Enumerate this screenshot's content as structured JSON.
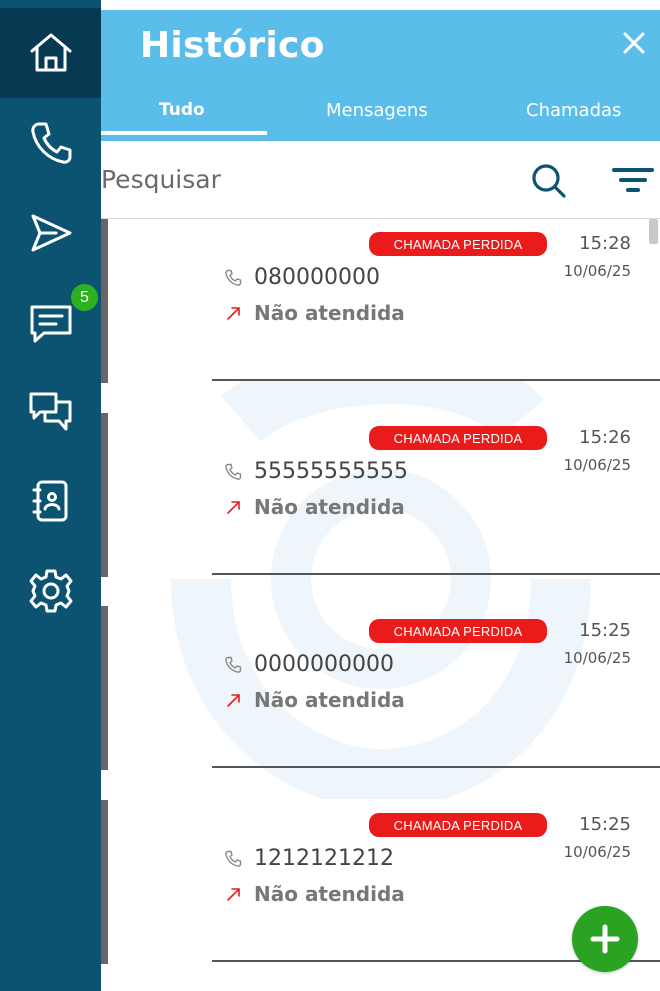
{
  "sidebar": {
    "items": [
      {
        "icon": "home-icon"
      },
      {
        "icon": "phone-icon"
      },
      {
        "icon": "send-icon"
      },
      {
        "icon": "message-icon",
        "badge": "5"
      },
      {
        "icon": "chat-icon"
      },
      {
        "icon": "contacts-icon"
      },
      {
        "icon": "gear-icon"
      }
    ],
    "badge_color": "#2db11f"
  },
  "header": {
    "title": "Histórico",
    "close_icon": "close-icon",
    "tabs": [
      {
        "label": "Tudo",
        "active": true
      },
      {
        "label": "Mensagens",
        "active": false
      },
      {
        "label": "Chamadas",
        "active": false
      }
    ]
  },
  "search": {
    "placeholder": "Pesquisar",
    "search_icon": "search-icon",
    "filter_icon": "filter-icon"
  },
  "history": [
    {
      "tag": "CHAMADA PERDIDA",
      "time": "15:28",
      "date": "10/06/25",
      "number": "080000000",
      "status": "Não atendida"
    },
    {
      "tag": "CHAMADA PERDIDA",
      "time": "15:26",
      "date": "10/06/25",
      "number": "55555555555",
      "status": "Não atendida"
    },
    {
      "tag": "CHAMADA PERDIDA",
      "time": "15:25",
      "date": "10/06/25",
      "number": "0000000000",
      "status": "Não atendida"
    },
    {
      "tag": "CHAMADA PERDIDA",
      "time": "15:25",
      "date": "10/06/25",
      "number": "1212121212",
      "status": "Não atendida"
    }
  ],
  "fab": {
    "icon": "plus-icon"
  },
  "colors": {
    "sidebar": "#0c5372",
    "header": "#5bbde9",
    "missed_tag": "#e91b1b",
    "fab": "#29a321"
  }
}
